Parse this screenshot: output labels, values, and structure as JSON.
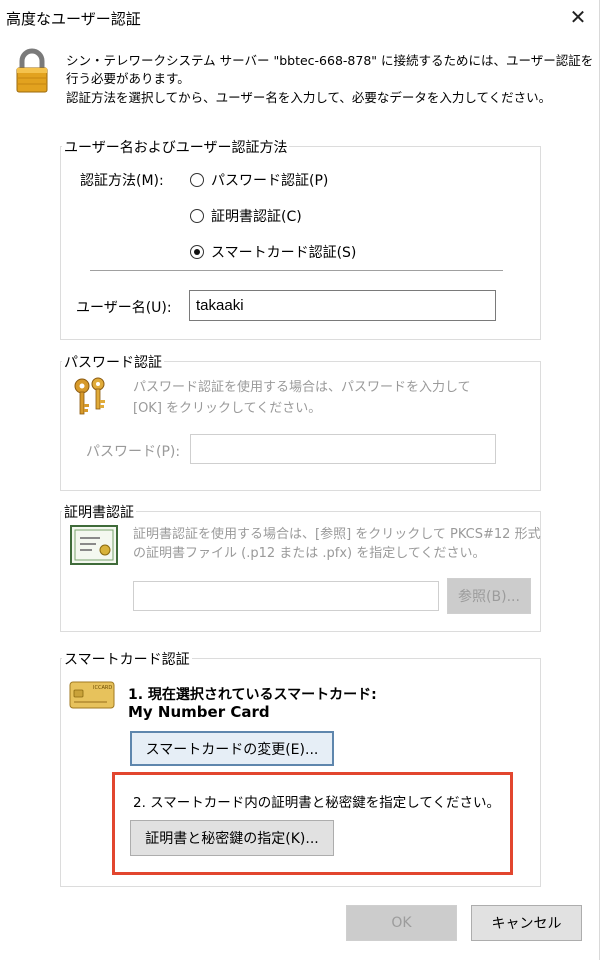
{
  "window": {
    "title": "高度なユーザー認証",
    "close_glyph": "✕"
  },
  "intro": {
    "line1": "シン・テレワークシステム サーバー \"bbtec-668-878\" に接続するためには、ユーザー認証を",
    "line2": "行う必要があります。",
    "line3": "認証方法を選択してから、ユーザー名を入力して、必要なデータを入力してください。"
  },
  "user_group": {
    "legend": "ユーザー名およびユーザー認証方法",
    "method_label": "認証方法(M):",
    "options": [
      {
        "label": "パスワード認証(P)",
        "selected": false
      },
      {
        "label": "証明書認証(C)",
        "selected": false
      },
      {
        "label": "スマートカード認証(S)",
        "selected": true
      }
    ],
    "username_label": "ユーザー名(U):",
    "username_value": "takaaki"
  },
  "password_group": {
    "legend": "パスワード認証",
    "hint_line1": "パスワード認証を使用する場合は、パスワードを入力して",
    "hint_line2": "[OK] をクリックしてください。",
    "password_label": "パスワード(P):",
    "password_value": "",
    "icon": "keys-icon"
  },
  "cert_group": {
    "legend": "証明書認証",
    "hint_line1": "証明書認証を使用する場合は、[参照] をクリックして PKCS#12 形式",
    "hint_line2": "の証明書ファイル (.p12 または .pfx) を指定してください。",
    "file_value": "",
    "browse_label": "参照(B)...",
    "icon": "certificate-icon"
  },
  "smartcard_group": {
    "legend": "スマートカード認証",
    "step1_title": "1. 現在選択されているスマートカード:",
    "step1_card": "My Number Card",
    "change_label": "スマートカードの変更(E)...",
    "step2_title": "2. スマートカード内の証明書と秘密鍵を指定してください。",
    "specify_label": "証明書と秘密鍵の指定(K)...",
    "card_icon_text": "ICCARD",
    "icon": "smartcard-icon"
  },
  "footer": {
    "ok_label": "OK",
    "cancel_label": "キャンセル"
  },
  "colors": {
    "highlight": "#e2462f",
    "lock_body": "#e2a21f",
    "lock_shackle": "#7a7a7a",
    "key": "#d79a2b",
    "card": "#e7c25c",
    "focus_border": "#5e86ad"
  }
}
